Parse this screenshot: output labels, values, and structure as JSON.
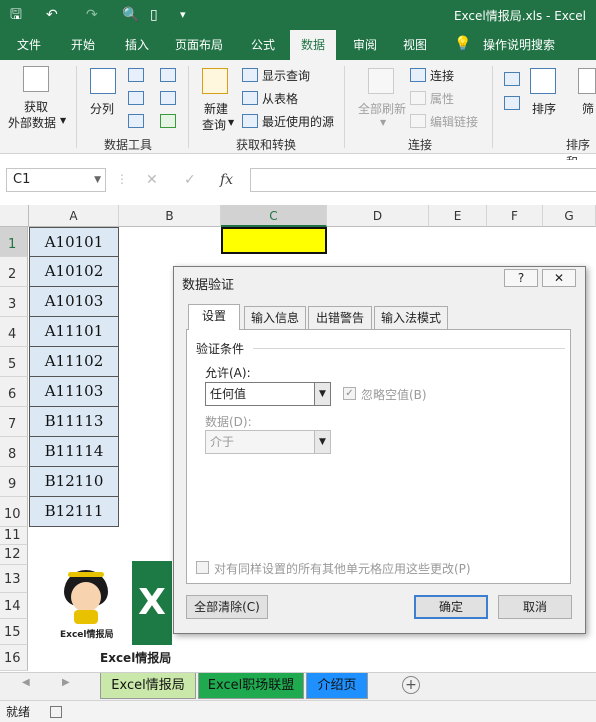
{
  "window": {
    "title": "Excel情报局.xls - Excel"
  },
  "ribbon_tabs": [
    "文件",
    "开始",
    "插入",
    "页面布局",
    "公式",
    "数据",
    "审阅",
    "视图",
    "操作说明搜索"
  ],
  "active_tab": "数据",
  "ribbon": {
    "get_external": {
      "label1": "获取",
      "label2": "外部数据"
    },
    "data_tools": {
      "split": "分列",
      "group_label": "数据工具"
    },
    "get_transform": {
      "new_query1": "新建",
      "new_query2": "查询",
      "show_queries": "显示查询",
      "from_table": "从表格",
      "recent_sources": "最近使用的源",
      "group_label": "获取和转换"
    },
    "connections": {
      "refresh_all": "全部刷新",
      "connections": "连接",
      "properties": "属性",
      "edit_links": "编辑链接",
      "group_label": "连接"
    },
    "sort_filter": {
      "sort": "排序",
      "group_label": "排序和",
      "filter": "筛"
    }
  },
  "namebox": {
    "value": "C1"
  },
  "fx_label": "fx",
  "columns": [
    "A",
    "B",
    "C",
    "D",
    "E",
    "F",
    "G"
  ],
  "rows": [
    "1",
    "2",
    "3",
    "4",
    "5",
    "6",
    "7",
    "8",
    "9",
    "10",
    "11",
    "12",
    "13",
    "14",
    "15",
    "16"
  ],
  "column_a_values": [
    "A10101",
    "A10102",
    "A10103",
    "A11101",
    "A11102",
    "A11103",
    "B11113",
    "B11114",
    "B12110",
    "B12111"
  ],
  "selected_cell": {
    "fill_color": "#ffff00"
  },
  "dialog": {
    "title": "数据验证",
    "help": "?",
    "close": "✕",
    "tabs": [
      "设置",
      "输入信息",
      "出错警告",
      "输入法模式"
    ],
    "active_tab": "设置",
    "section": "验证条件",
    "allow_label": "允许(A):",
    "allow_value": "任何值",
    "ignore_blank_label": "忽略空值(B)",
    "ignore_blank_checked": true,
    "data_label": "数据(D):",
    "data_value": "介于",
    "apply_all_label": "对有同样设置的所有其他单元格应用这些更改(P)",
    "clear_all": "全部清除(C)",
    "ok": "确定",
    "cancel": "取消"
  },
  "logo_text": "Excel情报局",
  "avatar_text": "Excel情报局",
  "sheet_tabs": [
    {
      "label": "Excel情报局",
      "color": "#c9e8a9"
    },
    {
      "label": "Excel职场联盟",
      "color": "#1faa4f"
    },
    {
      "label": "介绍页",
      "color": "#1e90ff"
    }
  ],
  "status": {
    "text": "就绪"
  },
  "colors": {
    "brand": "#217346",
    "column_a_fill": "#dce9f5"
  }
}
